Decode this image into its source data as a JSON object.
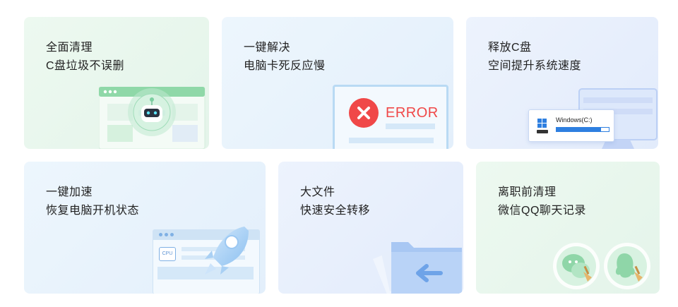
{
  "cards": [
    {
      "line1": "全面清理",
      "line2": "C盘垃圾不误删"
    },
    {
      "line1": "一键解决",
      "line2": "电脑卡死反应慢",
      "error_label": "ERROR"
    },
    {
      "line1": "释放C盘",
      "line2": "空间提升系统速度",
      "drive_label": "Windows(C:)",
      "drive_usage": 0.85
    },
    {
      "line1": "一键加速",
      "line2": "恢复电脑开机状态",
      "cpu_label": "CPU"
    },
    {
      "line1": "大文件",
      "line2": "快速安全转移"
    },
    {
      "line1": "离职前清理",
      "line2": "微信QQ聊天记录"
    }
  ],
  "colors": {
    "card1_bg": "#eaf8ee",
    "card2_bg": "#e9f4fc",
    "card3_bg": "#e8f0fd",
    "card4_bg": "#e9f3fc",
    "card5_bg": "#e8f0fd",
    "card6_bg": "#e9f8ee",
    "error_red": "#f04848",
    "accent_blue": "#2e7fe0"
  }
}
